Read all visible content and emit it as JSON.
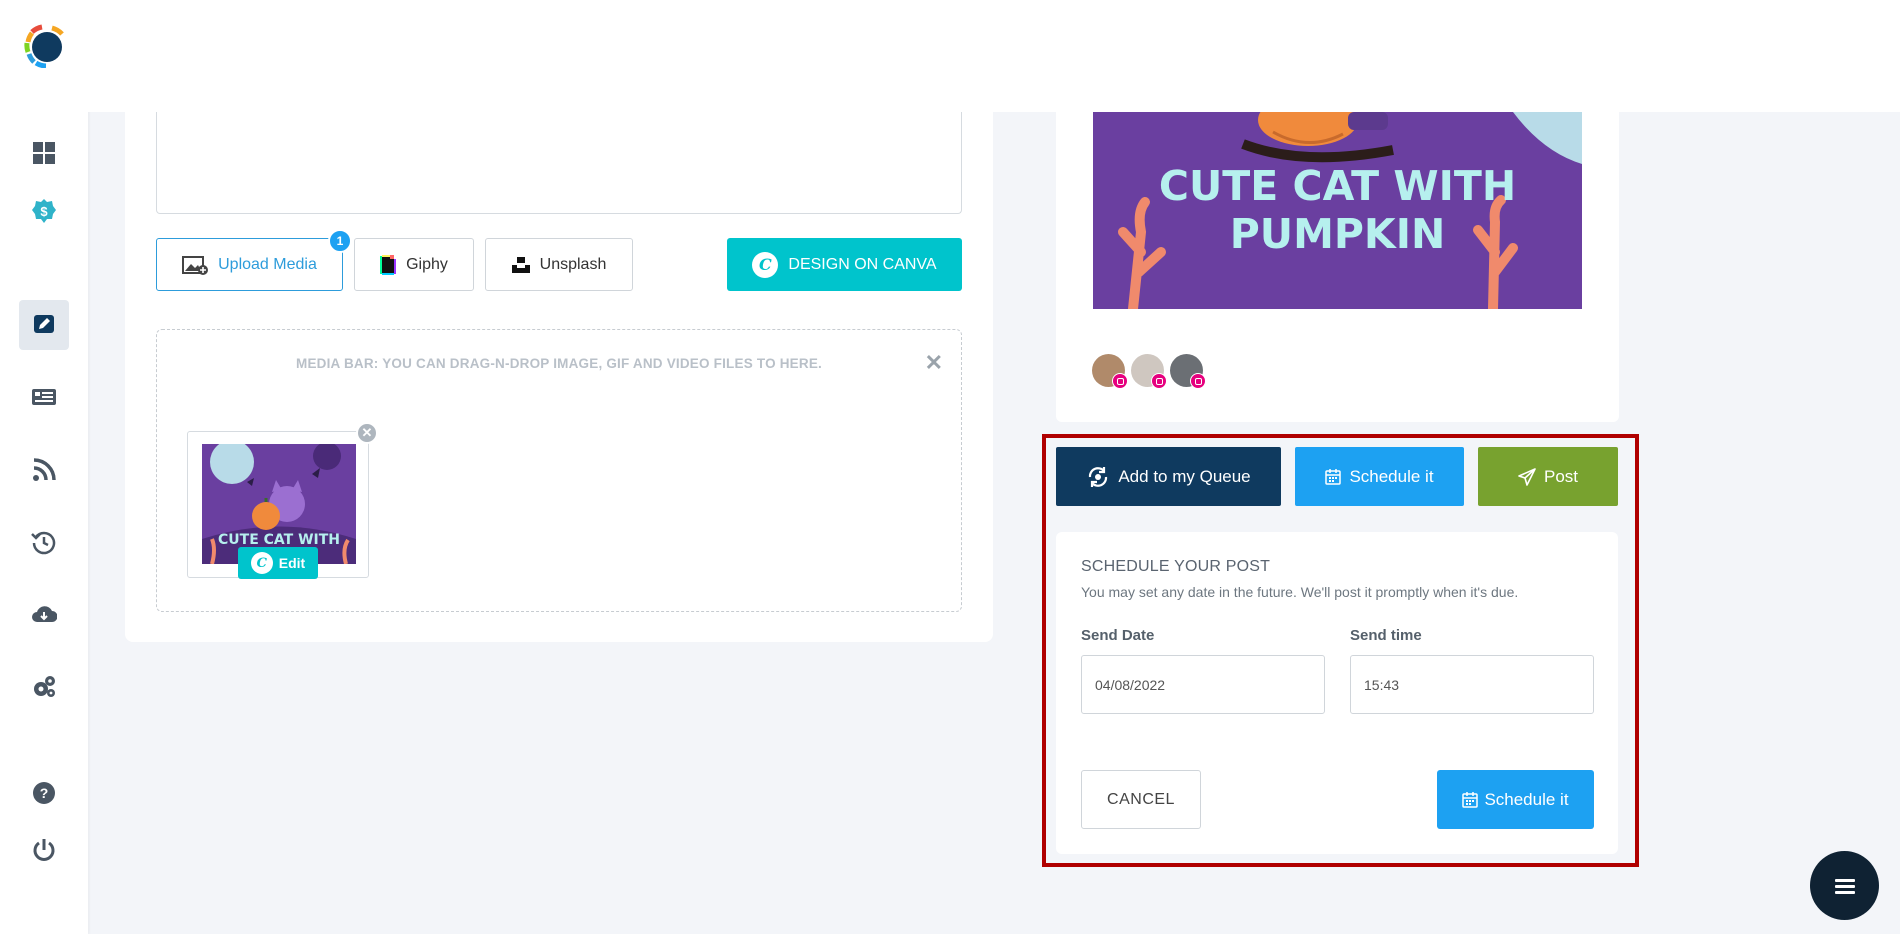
{
  "sidebar": {
    "items": [
      "dashboard-icon",
      "billing-icon",
      "compose-icon",
      "feed-icon",
      "rss-icon",
      "history-icon",
      "cloud-download-icon",
      "settings-icon",
      "help-icon",
      "power-icon"
    ]
  },
  "editor": {
    "upload_label": "Upload Media",
    "upload_badge": "1",
    "giphy_label": "Giphy",
    "unsplash_label": "Unsplash",
    "canva_label": "DESIGN ON CANVA",
    "media_bar_text": "MEDIA BAR: YOU CAN DRAG-N-DROP IMAGE, GIF AND VIDEO FILES TO HERE.",
    "thumb_caption": "CUTE CAT WITH",
    "edit_label": "Edit"
  },
  "preview": {
    "image_title_line1": "CUTE CAT WITH",
    "image_title_line2": "PUMPKIN"
  },
  "actions": {
    "queue_label": "Add to my Queue",
    "schedule_label": "Schedule it",
    "post_label": "Post"
  },
  "schedule": {
    "title": "SCHEDULE YOUR POST",
    "subtitle": "You may set any date in the future. We'll post it promptly when it's due.",
    "date_label": "Send Date",
    "date_value": "04/08/2022",
    "time_label": "Send time",
    "time_value": "15:43",
    "cancel_label": "CANCEL",
    "schedule_label": "Schedule it"
  },
  "colors": {
    "accent": "#1da1f2",
    "canva": "#00c4cc",
    "queue": "#0f3a5f",
    "post": "#78a22f",
    "highlight": "#b00000"
  }
}
